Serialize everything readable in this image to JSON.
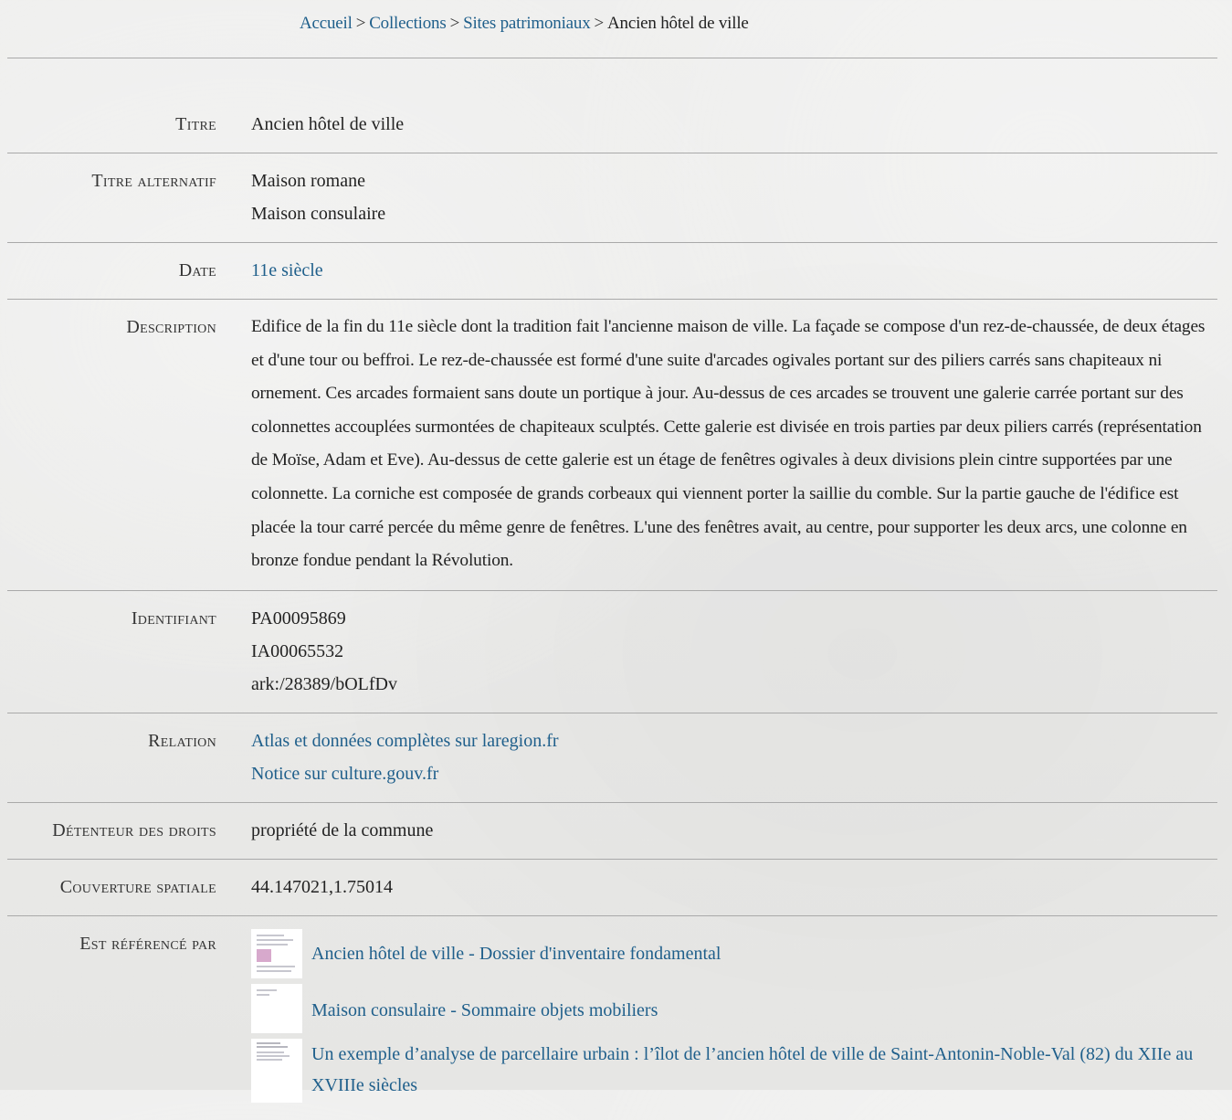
{
  "breadcrumb": {
    "items": [
      {
        "label": "Accueil"
      },
      {
        "label": "Collections"
      },
      {
        "label": "Sites patrimoniaux"
      }
    ],
    "current": "Ancien hôtel de ville",
    "separator": ">"
  },
  "metadata": {
    "title": {
      "label": "Titre",
      "value": "Ancien hôtel de ville"
    },
    "alt_title": {
      "label": "Titre alternatif",
      "values": [
        "Maison romane",
        "Maison consulaire"
      ]
    },
    "date": {
      "label": "Date",
      "value": "11e siècle"
    },
    "description": {
      "label": "Description",
      "value": "Edifice de la fin du 11e siècle dont la tradition fait l'ancienne maison de ville. La façade se compose d'un rez-de-chaussée, de deux étages et d'une tour ou beffroi. Le rez-de-chaussée est formé d'une suite d'arcades ogivales portant sur des piliers carrés sans chapiteaux ni ornement. Ces arcades formaient sans doute un portique à jour. Au-dessus de ces arcades se trouvent une galerie carrée portant sur des colonnettes accouplées surmontées de chapiteaux sculptés. Cette galerie est divisée en trois parties par deux piliers carrés (représentation de Moïse, Adam et Eve). Au-dessus de cette galerie est un étage de fenêtres ogivales à deux divisions plein cintre supportées par une colonnette. La corniche est composée de grands corbeaux qui viennent porter la saillie du comble. Sur la partie gauche de l'édifice est placée la tour carré percée du même genre de fenêtres. L'une des fenêtres avait, au centre, pour supporter les deux arcs, une colonne en bronze fondue pendant la Révolution."
    },
    "identifier": {
      "label": "Identifiant",
      "values": [
        "PA00095869",
        "IA00065532",
        "ark:/28389/bOLfDv"
      ]
    },
    "relation": {
      "label": "Relation",
      "links": [
        "Atlas et données complètes sur laregion.fr",
        "Notice sur culture.gouv.fr"
      ]
    },
    "rights_holder": {
      "label": "Détenteur des droits",
      "value": "propriété de la commune"
    },
    "spatial": {
      "label": "Couverture spatiale",
      "value": "44.147021,1.75014"
    },
    "referenced_by": {
      "label": "Est référencé par",
      "items": [
        {
          "title": "Ancien hôtel de ville - Dossier d'inventaire fondamental"
        },
        {
          "title": "Maison consulaire - Sommaire objets mobiliers"
        },
        {
          "title": "Un exemple d’analyse de parcellaire urbain : l’îlot de l’ancien hôtel de ville de Saint-Antonin-Noble-Val (82) du XIIe au XVIIIe siècles"
        }
      ]
    }
  },
  "colors": {
    "link": "#1f5f8b",
    "text": "#222222",
    "rule": "#a9a9a9",
    "background": "#ebebea"
  }
}
